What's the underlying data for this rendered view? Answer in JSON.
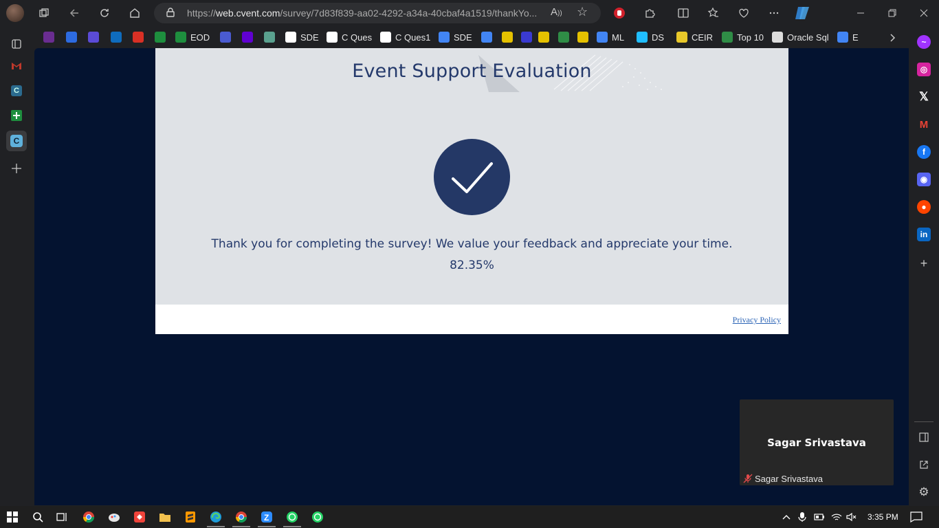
{
  "browser": {
    "url_prefix": "https://",
    "url_host": "web.cvent.com",
    "url_path": "/survey/7d83f839-aa02-4292-a34a-40cbaf4a1519/thankYo..."
  },
  "bookmarks": [
    {
      "label": "",
      "icon": "purple-app-icon",
      "color": "#6a2d91"
    },
    {
      "label": "",
      "icon": "compass-icon",
      "color": "#2d6be0"
    },
    {
      "label": "",
      "icon": "to-icon",
      "color": "#5b4bd6"
    },
    {
      "label": "",
      "icon": "outlook-icon",
      "color": "#0f6cbd"
    },
    {
      "label": "",
      "icon": "gmail-icon",
      "color": "#d93025"
    },
    {
      "label": "",
      "icon": "sheets-icon",
      "color": "#1e8e3e"
    },
    {
      "label": "EOD",
      "icon": "sheets-icon",
      "color": "#1e8e3e"
    },
    {
      "label": "",
      "icon": "link-icon",
      "color": "#4a5bd0"
    },
    {
      "label": "",
      "icon": "yahoo-icon",
      "color": "#6001d2"
    },
    {
      "label": "",
      "icon": "chatgpt-icon",
      "color": "#5aa18f"
    },
    {
      "label": "SDE",
      "icon": "github-icon",
      "color": "#ffffff"
    },
    {
      "label": "C Ques",
      "icon": "github-icon",
      "color": "#ffffff"
    },
    {
      "label": "C Ques1",
      "icon": "github-icon",
      "color": "#ffffff"
    },
    {
      "label": "SDE",
      "icon": "google-icon",
      "color": "#4285f4"
    },
    {
      "label": "",
      "icon": "google-icon",
      "color": "#4285f4"
    },
    {
      "label": "",
      "icon": "python-icon",
      "color": "#e5c100"
    },
    {
      "label": "",
      "icon": "bracket-icon",
      "color": "#3a3ad0"
    },
    {
      "label": "",
      "icon": "python-icon",
      "color": "#e5c100"
    },
    {
      "label": "",
      "icon": "gfg-icon",
      "color": "#2f8d46"
    },
    {
      "label": "",
      "icon": "python-icon",
      "color": "#e5c100"
    },
    {
      "label": "ML",
      "icon": "google-icon",
      "color": "#4285f4"
    },
    {
      "label": "DS",
      "icon": "k-icon",
      "color": "#20beff"
    },
    {
      "label": "CEIR",
      "icon": "ceir-icon",
      "color": "#e8c82a"
    },
    {
      "label": "Top 10",
      "icon": "gfg-icon",
      "color": "#2f8d46"
    },
    {
      "label": "Oracle Sql",
      "icon": "page-icon",
      "color": "#dddddd"
    },
    {
      "label": "E",
      "icon": "google-icon",
      "color": "#4285f4"
    }
  ],
  "survey": {
    "title": "Event Support Evaluation",
    "thanks": "Thank you for completing the survey! We value your feedback and appreciate your time.",
    "progress_text": "82.35%",
    "progress_value": 82.35,
    "privacy_link": "Privacy Policy"
  },
  "participant": {
    "tile_name": "Sagar Srivastava",
    "label": "Sagar Srivastava"
  },
  "taskbar": {
    "time": "3:35 PM"
  },
  "colors": {
    "brand_navy": "#243866",
    "page_bg": "#041330",
    "card_bg": "#dfe2e6"
  }
}
